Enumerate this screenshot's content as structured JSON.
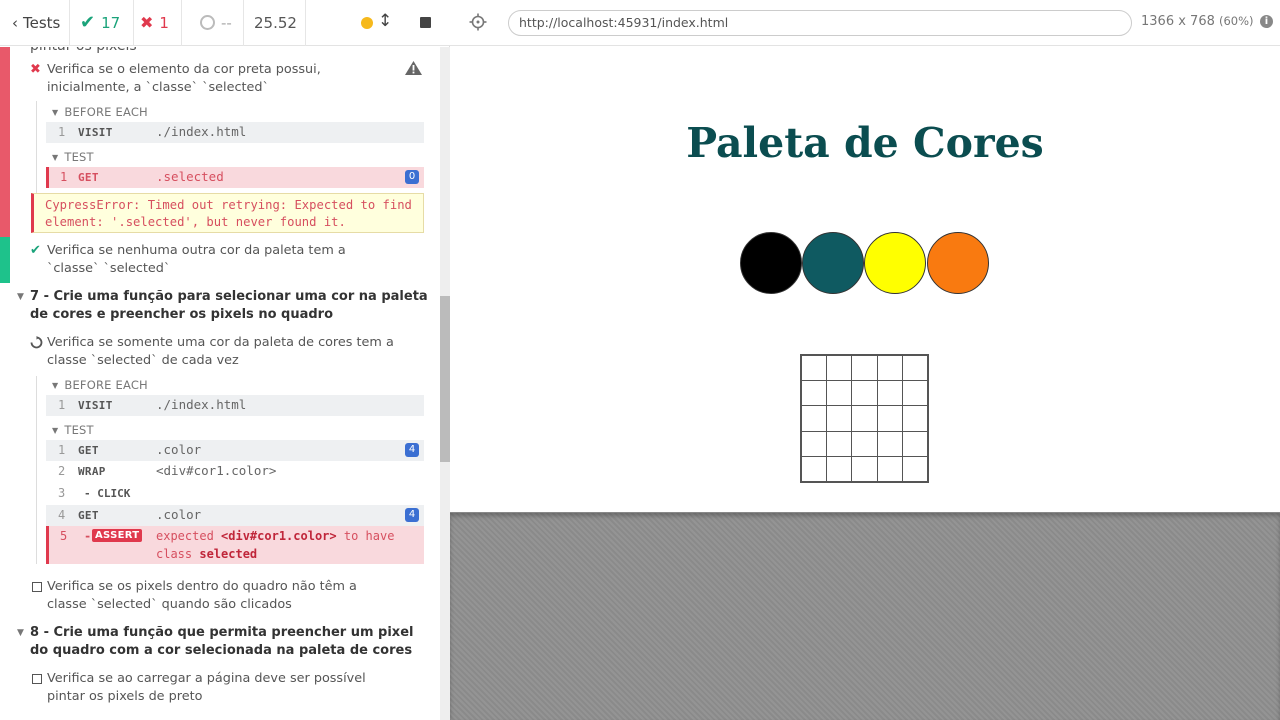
{
  "header": {
    "tests_label": "Tests",
    "passed": "17",
    "failed": "1",
    "pending": "--",
    "duration": "25.52"
  },
  "reporter": {
    "partial_top_text": "pintar os pixels",
    "test1": {
      "title": "Verifica se o elemento da cor preta possui, inicialmente, a `classe` `selected`",
      "before_each_label": "BEFORE EACH",
      "test_label": "TEST",
      "before_cmds": [
        {
          "num": "1",
          "name": "VISIT",
          "msg": "./index.html"
        }
      ],
      "test_cmds": [
        {
          "num": "1",
          "name": "GET",
          "msg": ".selected",
          "badge": "0"
        }
      ],
      "error": "CypressError: Timed out retrying: Expected to find element: '.selected', but never found it."
    },
    "test2": {
      "title": "Verifica se nenhuma outra cor da paleta tem a `classe` `selected`"
    },
    "suite7": {
      "title": "7 - Crie uma função para selecionar uma cor na paleta de cores e preencher os pixels no quadro",
      "running_test": "Verifica se somente uma cor da paleta de cores tem a classe `selected` de cada vez",
      "before_each_label": "BEFORE EACH",
      "test_label": "TEST",
      "before_cmds": [
        {
          "num": "1",
          "name": "VISIT",
          "msg": "./index.html"
        }
      ],
      "test_cmds": [
        {
          "num": "1",
          "name": "GET",
          "msg": ".color",
          "badge": "4"
        },
        {
          "num": "2",
          "name": "WRAP",
          "msg": "<div#cor1.color>"
        },
        {
          "num": "3",
          "name": "- CLICK",
          "msg": ""
        },
        {
          "num": "4",
          "name": "GET",
          "msg": ".color",
          "badge": "4"
        }
      ],
      "assert": {
        "num": "5",
        "dash": "-",
        "tag": "ASSERT",
        "expected": "expected",
        "subject": "<div#cor1.color>",
        "to_have": "to have",
        "class_word": "class",
        "class_value": "selected"
      },
      "pending_test": "Verifica se os pixels dentro do quadro não têm a classe `selected` quando são clicados"
    },
    "suite8": {
      "title": "8 - Crie uma função que permita preencher um pixel do quadro com a cor selecionada na paleta de cores",
      "pending_test": "Verifica se ao carregar a página deve ser possível pintar os pixels de preto"
    }
  },
  "app_header": {
    "url": "http://localhost:45931/index.html",
    "viewport": "1366 x 768",
    "scale": "(60%)",
    "info": "i"
  },
  "app": {
    "title": "Paleta de Cores",
    "palette": [
      "#000000",
      "#0f5a61",
      "#ffff00",
      "#f97a10"
    ],
    "board_size": 5
  },
  "colors": {
    "pass": "#1aa37a",
    "fail": "#e0394d",
    "badge": "#3b6fd2",
    "title": "#0b4d50"
  }
}
